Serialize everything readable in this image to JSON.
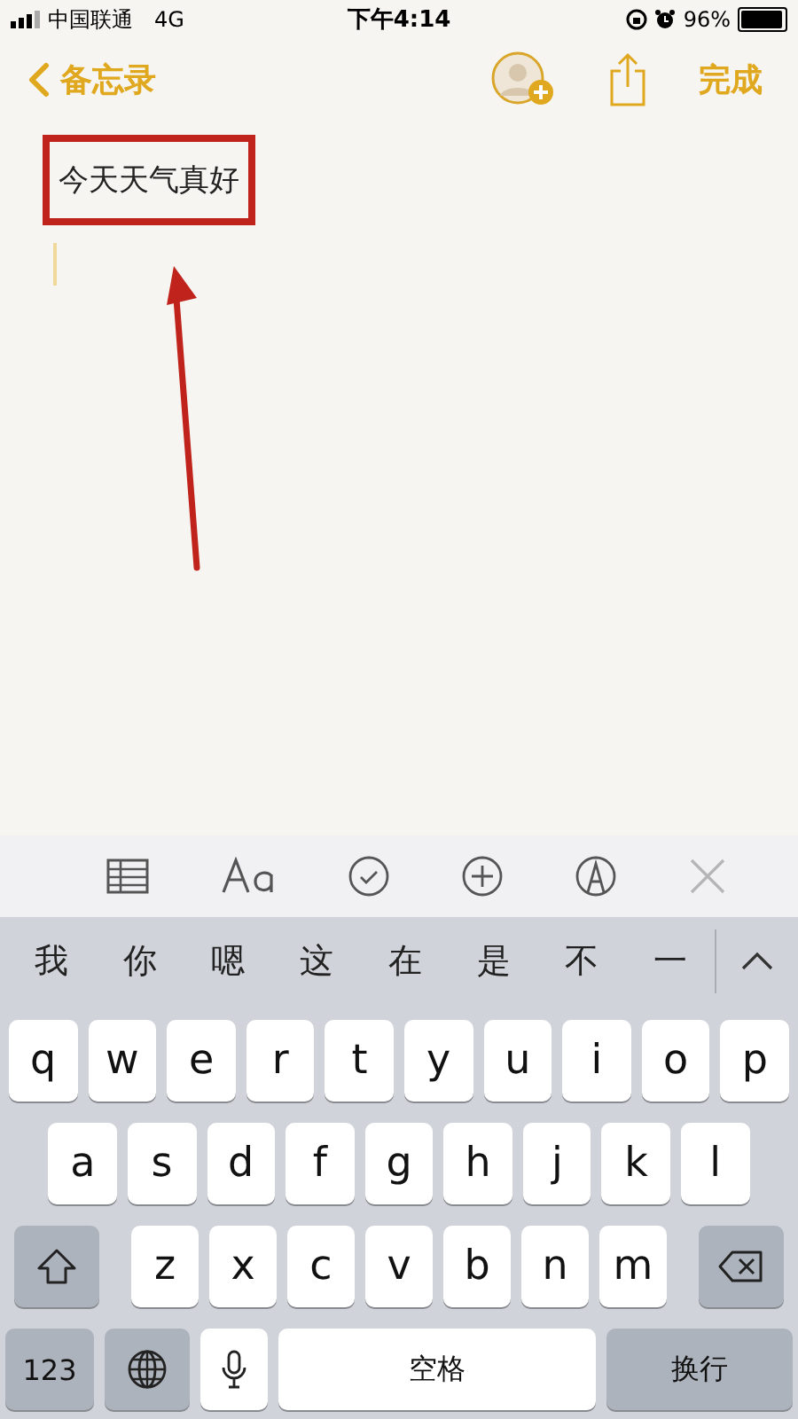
{
  "status_bar": {
    "carrier": "中国联通",
    "network": "4G",
    "time": "下午4:14",
    "battery": "96%"
  },
  "nav": {
    "back": "备忘录",
    "done": "完成"
  },
  "note": {
    "text": "今天天气真好",
    "highlighted": true
  },
  "candidates": [
    "我",
    "你",
    "嗯",
    "这",
    "在",
    "是",
    "不",
    "一"
  ],
  "keyboard": {
    "top_row": [
      {
        "kind": "letter",
        "label": "q"
      },
      {
        "kind": "letter",
        "label": "w"
      },
      {
        "kind": "letter",
        "label": "e"
      },
      {
        "kind": "letter",
        "label": "r"
      },
      {
        "kind": "letter",
        "label": "t"
      },
      {
        "kind": "letter",
        "label": "y"
      },
      {
        "kind": "letter",
        "label": "u"
      },
      {
        "kind": "letter",
        "label": "i"
      },
      {
        "kind": "letter",
        "label": "o"
      },
      {
        "kind": "letter",
        "label": "p"
      }
    ],
    "middle_row": [
      {
        "kind": "letter",
        "label": "a"
      },
      {
        "kind": "letter",
        "label": "s"
      },
      {
        "kind": "letter",
        "label": "d"
      },
      {
        "kind": "letter",
        "label": "f"
      },
      {
        "kind": "letter",
        "label": "g"
      },
      {
        "kind": "letter",
        "label": "h"
      },
      {
        "kind": "letter",
        "label": "j"
      },
      {
        "kind": "letter",
        "label": "k"
      },
      {
        "kind": "letter",
        "label": "l"
      }
    ],
    "lower_row": [
      {
        "kind": "shift"
      },
      {
        "kind": "letter",
        "label": "z"
      },
      {
        "kind": "letter",
        "label": "x"
      },
      {
        "kind": "letter",
        "label": "c"
      },
      {
        "kind": "letter",
        "label": "v"
      },
      {
        "kind": "letter",
        "label": "b"
      },
      {
        "kind": "letter",
        "label": "n"
      },
      {
        "kind": "letter",
        "label": "m"
      },
      {
        "kind": "delete"
      }
    ],
    "bottom_row": [
      {
        "kind": "numbers",
        "label": "123"
      },
      {
        "kind": "globe"
      },
      {
        "kind": "mic"
      },
      {
        "kind": "space",
        "label": "空格"
      },
      {
        "kind": "return",
        "label": "换行"
      }
    ]
  }
}
